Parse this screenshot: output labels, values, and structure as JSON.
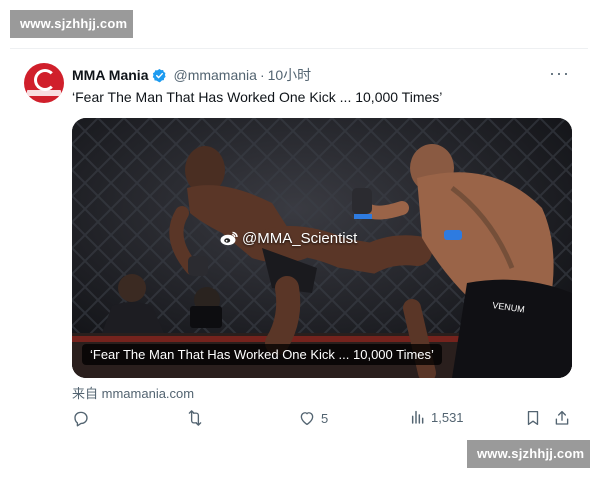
{
  "watermarks": {
    "top": "www.sjzhhjj.com",
    "bottom": "www.sjzhhjj.com"
  },
  "tweet": {
    "author_name": "MMA Mania",
    "handle": "@mmamania",
    "separator": "·",
    "time": "10小时",
    "text": "‘Fear The Man That Has Worked One Kick ... 10,000 Times’",
    "more": "···",
    "media": {
      "caption": "‘Fear The Man That Has Worked One Kick ... 10,000 Times’",
      "watermark_text": "@MMA_Scientist"
    },
    "source_label": "来自",
    "source_domain": "mmamania.com",
    "actions": {
      "reply_count": "",
      "retweet_count": "",
      "like_count": "5",
      "views_count": "1,531"
    }
  },
  "colors": {
    "verified": "#1d9bf0",
    "secondary_text": "#536471",
    "avatar": "#d01f2b"
  }
}
